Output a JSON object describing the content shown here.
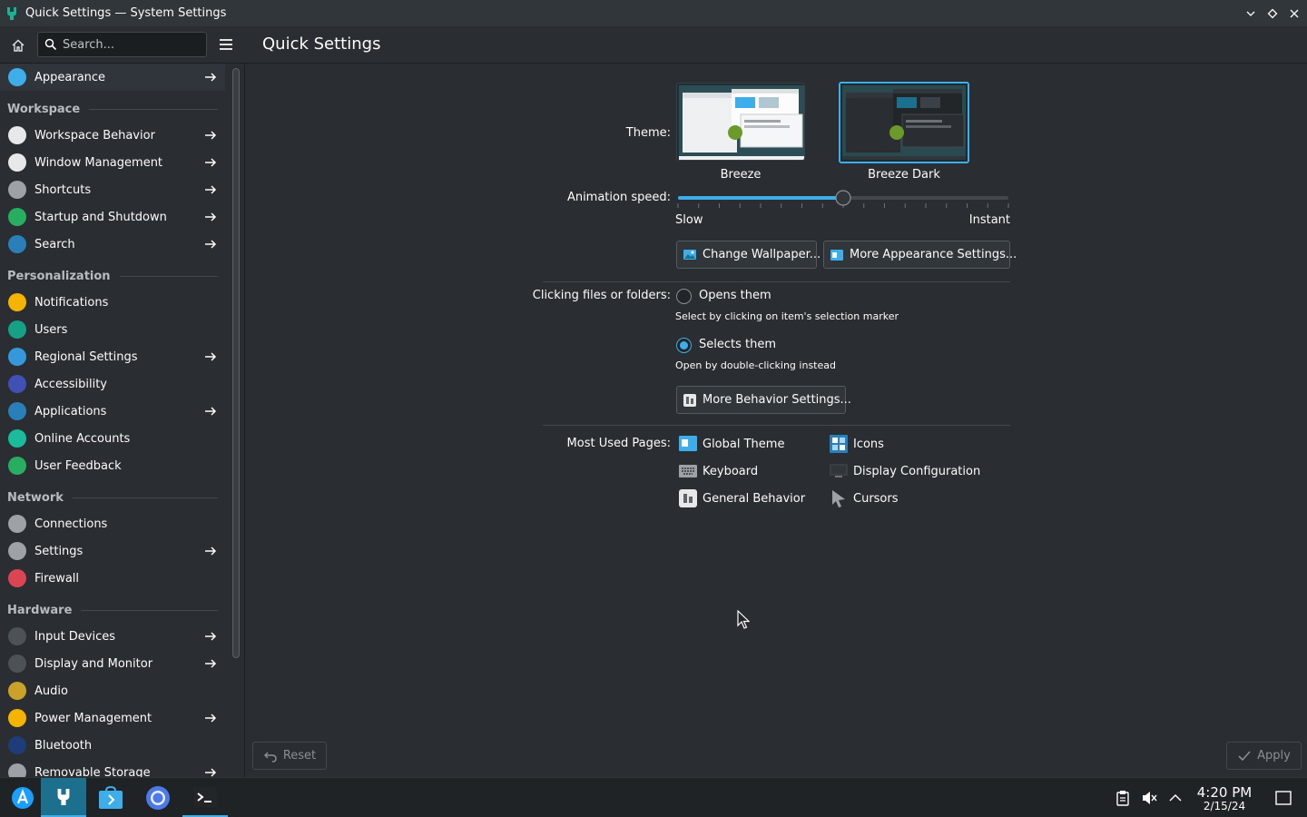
{
  "window": {
    "title": "Quick Settings — System Settings",
    "controls": [
      "minimize-icon",
      "maximize-icon",
      "close-icon"
    ]
  },
  "sidebar": {
    "search_placeholder": "Search...",
    "items": [
      {
        "label": "Appearance",
        "icon": "appearance-icon",
        "arrow": true,
        "color": "#3daee9"
      },
      {
        "section": "Workspace"
      },
      {
        "label": "Workspace Behavior",
        "icon": "workspace-behavior-icon",
        "arrow": true,
        "color": "#e6e8ea"
      },
      {
        "label": "Window Management",
        "icon": "window-management-icon",
        "arrow": true,
        "color": "#e6e8ea"
      },
      {
        "label": "Shortcuts",
        "icon": "keyboard-icon",
        "arrow": true,
        "color": "#9ea2a6"
      },
      {
        "label": "Startup and Shutdown",
        "icon": "rocket-icon",
        "arrow": true,
        "color": "#27ae60"
      },
      {
        "label": "Search",
        "icon": "search-icon",
        "arrow": true,
        "color": "#2980b9"
      },
      {
        "section": "Personalization"
      },
      {
        "label": "Notifications",
        "icon": "bell-icon",
        "arrow": false,
        "color": "#f4b400"
      },
      {
        "label": "Users",
        "icon": "user-icon",
        "arrow": false,
        "color": "#16a085"
      },
      {
        "label": "Regional Settings",
        "icon": "translate-icon",
        "arrow": true,
        "color": "#3498db"
      },
      {
        "label": "Accessibility",
        "icon": "accessibility-icon",
        "arrow": false,
        "color": "#3f51b5"
      },
      {
        "label": "Applications",
        "icon": "applications-icon",
        "arrow": true,
        "color": "#2980b9"
      },
      {
        "label": "Online Accounts",
        "icon": "at-icon",
        "arrow": false,
        "color": "#1abc9c"
      },
      {
        "label": "User Feedback",
        "icon": "feedback-icon",
        "arrow": false,
        "color": "#27ae60"
      },
      {
        "section": "Network"
      },
      {
        "label": "Connections",
        "icon": "connections-icon",
        "arrow": false,
        "color": "#9ea2a6"
      },
      {
        "label": "Settings",
        "icon": "network-settings-icon",
        "arrow": true,
        "color": "#9ea2a6"
      },
      {
        "label": "Firewall",
        "icon": "shield-icon",
        "arrow": false,
        "color": "#da4453"
      },
      {
        "section": "Hardware"
      },
      {
        "label": "Input Devices",
        "icon": "mouse-icon",
        "arrow": true,
        "color": "#4d5257"
      },
      {
        "label": "Display and Monitor",
        "icon": "monitor-icon",
        "arrow": true,
        "color": "#4d5257"
      },
      {
        "label": "Audio",
        "icon": "audio-icon",
        "arrow": false,
        "color": "#c9a227"
      },
      {
        "label": "Power Management",
        "icon": "power-icon",
        "arrow": true,
        "color": "#f4b400"
      },
      {
        "label": "Bluetooth",
        "icon": "bluetooth-icon",
        "arrow": false,
        "color": "#1d3c78"
      },
      {
        "label": "Removable Storage",
        "icon": "storage-icon",
        "arrow": true,
        "color": "#9ea2a6"
      }
    ]
  },
  "main": {
    "title": "Quick Settings",
    "theme_label": "Theme:",
    "themes": [
      {
        "name": "Breeze",
        "selected": false
      },
      {
        "name": "Breeze Dark",
        "selected": true
      }
    ],
    "animation_label": "Animation speed:",
    "animation_value": 0.5,
    "slider_min_label": "Slow",
    "slider_max_label": "Instant",
    "change_wallpaper_label": "Change Wallpaper...",
    "more_appearance_label": "More Appearance Settings...",
    "clicking_label": "Clicking files or folders:",
    "opens_label": "Opens them",
    "opens_hint": "Select by clicking on item's selection marker",
    "selects_label": "Selects them",
    "selects_hint": "Open by double-clicking instead",
    "clicking_selected": "selects",
    "more_behavior_label": "More Behavior Settings...",
    "most_used_label": "Most Used Pages:",
    "most_used": [
      {
        "label": "Global Theme",
        "icon": "global-theme-icon"
      },
      {
        "label": "Icons",
        "icon": "icons-icon"
      },
      {
        "label": "Keyboard",
        "icon": "keyboard-icon"
      },
      {
        "label": "Display Configuration",
        "icon": "display-icon"
      },
      {
        "label": "General Behavior",
        "icon": "general-behavior-icon"
      },
      {
        "label": "Cursors",
        "icon": "cursor-icon"
      }
    ],
    "reset_label": "Reset",
    "apply_label": "Apply"
  },
  "taskbar": {
    "time": "4:20 PM",
    "date": "2/15/24",
    "apps": [
      "launcher-icon",
      "system-settings-icon",
      "discover-icon",
      "chromium-icon",
      "konsole-icon"
    ]
  },
  "colors": {
    "accent": "#3daee9",
    "background": "#2a2e32",
    "titlebar": "#31363b"
  }
}
